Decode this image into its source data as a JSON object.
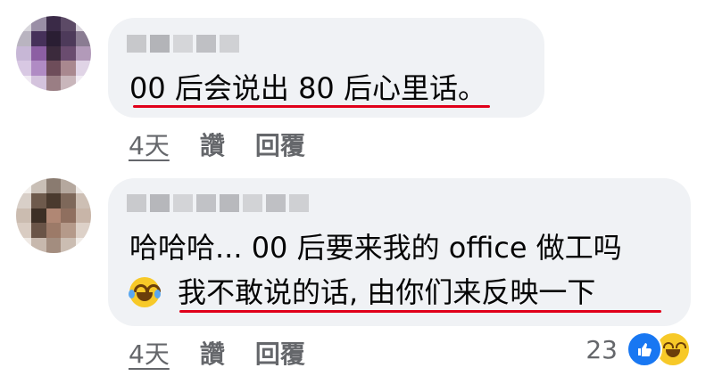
{
  "comments": [
    {
      "lines": [
        "00 后会说出 80 后心里话。"
      ],
      "actions": {
        "time": "4天",
        "like": "讚",
        "reply": "回覆"
      }
    },
    {
      "lines": [
        "哈哈哈... 00 后要来我的 office 做工吗",
        "我不敢说的话, 由你们来反映一下"
      ],
      "actions": {
        "time": "4天",
        "like": "讚",
        "reply": "回覆"
      },
      "reactions": {
        "count": "23",
        "icons": [
          "like-icon",
          "haha-icon"
        ]
      }
    }
  ],
  "colors": {
    "bubble": "#f0f2f5",
    "underline": "#e0001a",
    "meta": "#65676b",
    "like_blue": "#1877f2"
  }
}
